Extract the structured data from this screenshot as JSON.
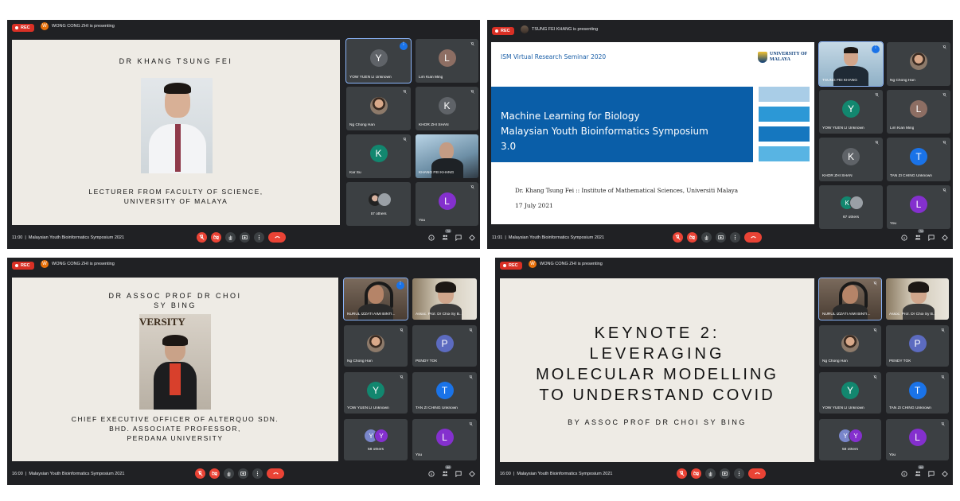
{
  "panels": [
    {
      "rec": "REC",
      "presenter_initial": "W",
      "presenting": "WONG CONG ZHI is presenting",
      "slide": {
        "title": "DR KHANG TSUNG FEI",
        "line1": "LECTURER FROM FACULTY OF SCIENCE,",
        "line2": "UNIVERSITY OF MALAYA"
      },
      "tiles": [
        {
          "name": "YOW YUEN LI Unknown",
          "initial": "Y"
        },
        {
          "name": "Lim Kian Ming",
          "initial": "L"
        },
        {
          "name": "Ng Chong Han"
        },
        {
          "name": "KHOR ZHI SHAN",
          "initial": "K"
        },
        {
          "name": "Kar Su",
          "initial": "K"
        },
        {
          "name": "KHANG FEI KHANG"
        },
        {
          "name": "67 others"
        },
        {
          "name": "You",
          "initial": "L"
        }
      ],
      "time": "11:00",
      "meeting": "Malaysian Youth Bioinformatics Symposium 2021",
      "people_count": "76"
    },
    {
      "rec": "REC",
      "presenting": "TSUNG FEI KHANG is presenting",
      "slide": {
        "header": "ISM Virtual Research Seminar 2020",
        "logo": "UNIVERSITY OF MALAYA",
        "title1": "Machine Learning for Biology",
        "title2": "Malaysian Youth Bioinformatics Symposium",
        "title3": "3.0",
        "author": "Dr. Khang Tsung Fei :: Institute of Mathematical Sciences, Universiti Malaya",
        "date": "17 July 2021"
      },
      "tiles": [
        {
          "name": "TSUNG FEI KHANG"
        },
        {
          "name": "Ng Chong Han"
        },
        {
          "name": "YOW YUEN LI Unknown",
          "initial": "Y"
        },
        {
          "name": "Lim Kian Ming",
          "initial": "L"
        },
        {
          "name": "KHOR ZHI SHAN",
          "initial": "K"
        },
        {
          "name": "TAN ZI CHING Unknown",
          "initial": "T"
        },
        {
          "name": "67 others",
          "initial": "K"
        },
        {
          "name": "You",
          "initial": "L"
        }
      ],
      "time": "11:01",
      "meeting": "Malaysian Youth Bioinformatics Symposium 2021",
      "people_count": "76"
    },
    {
      "rec": "REC",
      "presenter_initial": "W",
      "presenting": "WONG CONG ZHI is presenting",
      "slide": {
        "title1": "DR ASSOC PROF DR CHOI",
        "title2": "SY BING",
        "photo_text": "VERSITY",
        "line1": "CHIEF EXECUTIVE OFFICER OF ALTERQUO SDN.",
        "line2": "BHD. ASSOCIATE PROFESSOR,",
        "line3": "PERDANA UNIVERSITY"
      },
      "tiles": [
        {
          "name": "NURUL IZZATI AIMI BINTI..."
        },
        {
          "name": "Assoc. Prof. Dr Choi Sy B..."
        },
        {
          "name": "Ng Chong Han"
        },
        {
          "name": "PENDY TOK",
          "initial": "P"
        },
        {
          "name": "YOW YUEN LI Unknown",
          "initial": "Y"
        },
        {
          "name": "TAN ZI CHING Unknown",
          "initial": "T"
        },
        {
          "name": "58 others"
        },
        {
          "name": "You",
          "initial": "L"
        }
      ],
      "time": "16:00",
      "meeting": "Malaysian Youth Bioinformatics Symposium 2021",
      "people_count": "66"
    },
    {
      "rec": "REC",
      "presenter_initial": "W",
      "presenting": "WONG CONG ZHI is presenting",
      "slide": {
        "line1": "KEYNOTE 2:",
        "line2": "LEVERAGING",
        "line3": "MOLECULAR MODELLING",
        "line4": "TO UNDERSTAND COVID",
        "byline": "BY ASSOC PROF DR CHOI SY BING"
      },
      "tiles": [
        {
          "name": "NURUL IZZATI AIMI BINTI..."
        },
        {
          "name": "Assoc. Prof. Dr Choi Sy B..."
        },
        {
          "name": "Ng Chong Han"
        },
        {
          "name": "PENDY TOK",
          "initial": "P"
        },
        {
          "name": "YOW YUEN LI Unknown",
          "initial": "Y"
        },
        {
          "name": "TAN ZI CHING Unknown",
          "initial": "T"
        },
        {
          "name": "58 others"
        },
        {
          "name": "You",
          "initial": "L"
        }
      ],
      "time": "16:00",
      "meeting": "Malaysian Youth Bioinformatics Symposium 2021",
      "people_count": "66"
    }
  ],
  "colors": {
    "meet_bg": "#202124",
    "tile_bg": "#3c4043",
    "red": "#ea4335",
    "avatar_teal": "#12876f",
    "avatar_gray": "#5f6368",
    "avatar_brown": "#8d6e63",
    "avatar_blue": "#1a73e8",
    "avatar_purple": "#8430ce",
    "avatar_indigo": "#5c6bc0",
    "uom_blue": "#0a5ea8"
  }
}
